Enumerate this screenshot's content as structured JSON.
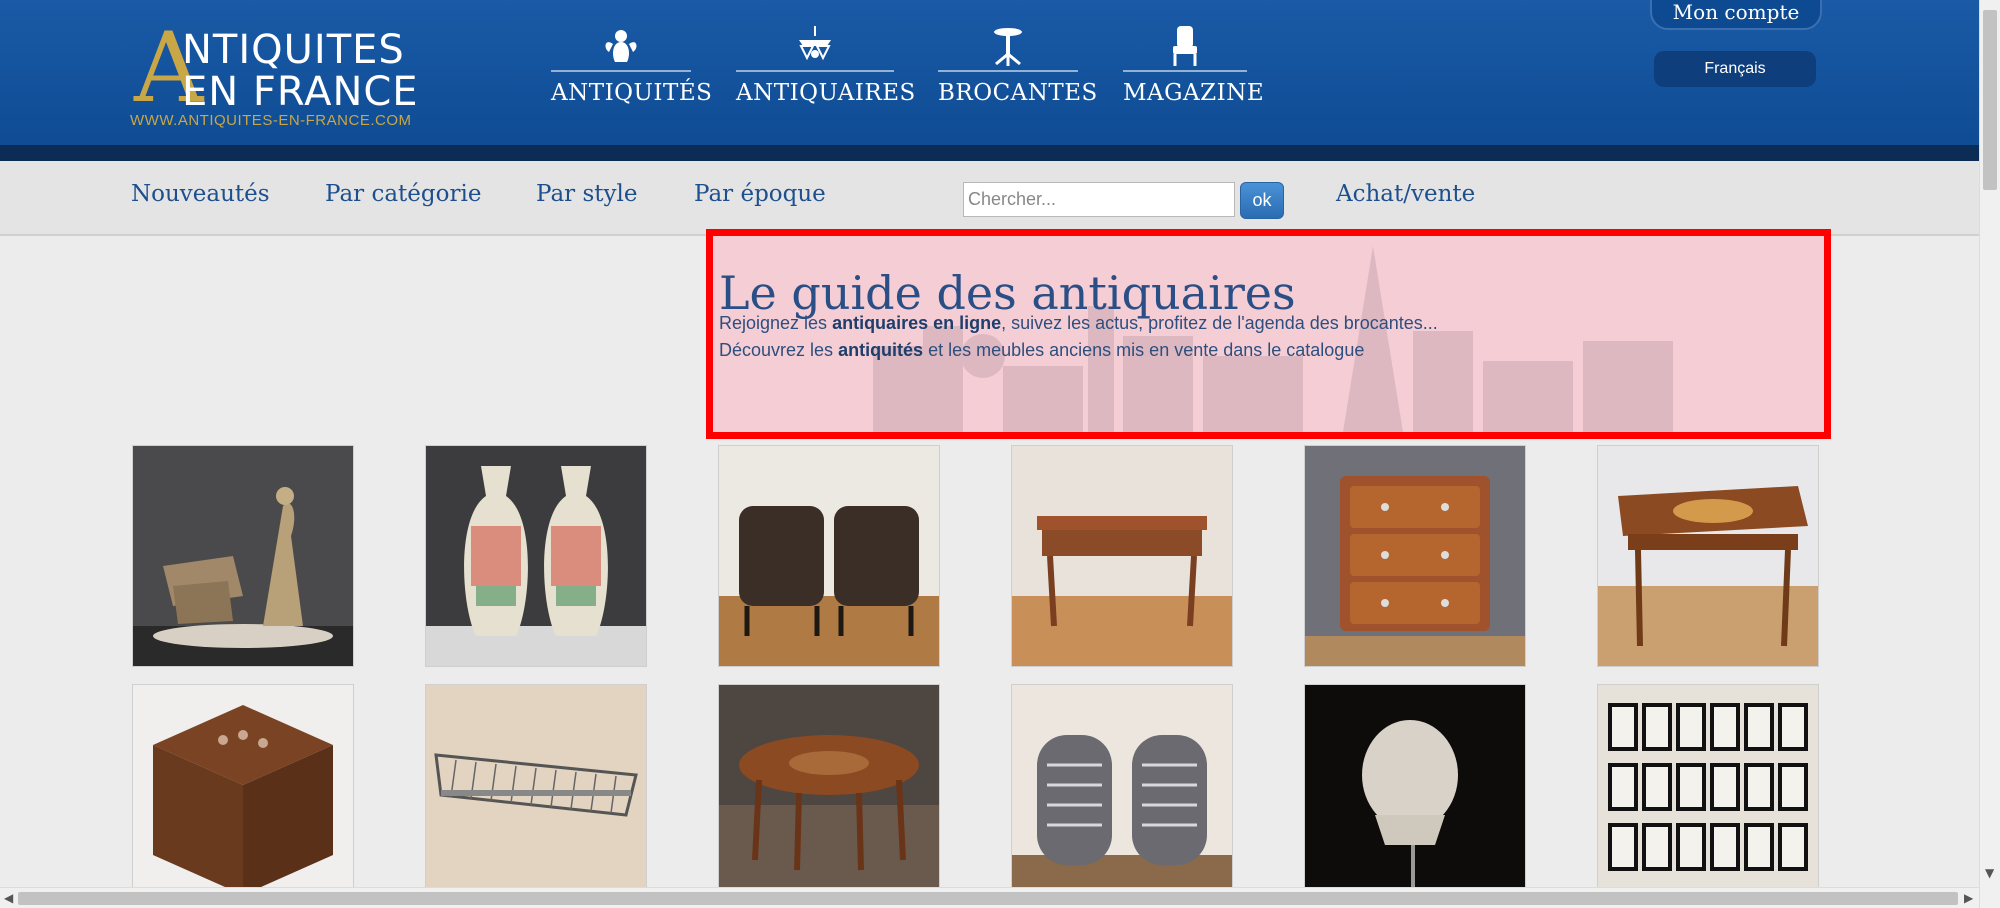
{
  "logo": {
    "big_letter": "A",
    "line1": "NTIQUITES",
    "line2": "EN FRANCE",
    "url": "WWW.ANTIQUITES-EN-FRANCE.COM"
  },
  "mainnav": [
    {
      "label": "ANTIQUITÉS",
      "icon": "cherub-icon"
    },
    {
      "label": "ANTIQUAIRES",
      "icon": "chandelier-icon"
    },
    {
      "label": "BROCANTES",
      "icon": "gueridon-table-icon"
    },
    {
      "label": "MAGAZINE",
      "icon": "armchair-icon"
    }
  ],
  "account": {
    "label": "Mon compte"
  },
  "language": {
    "selected": "Français"
  },
  "subnav": {
    "items": [
      "Nouveautés",
      "Par catégorie",
      "Par style",
      "Par époque"
    ],
    "search_placeholder": "Chercher...",
    "search_button": "ok",
    "achat_vente": "Achat/vente"
  },
  "hero": {
    "title": "Le guide des antiquaires",
    "line1_pre": "Rejoignez les ",
    "line1_bold": "antiquaires en ligne",
    "line1_post": ", suivez les actus, profitez de l'agenda des brocantes...",
    "line2_pre": "Découvrez les ",
    "line2_bold": "antiquités",
    "line2_post": " et les meubles anciens mis en vente dans le catalogue"
  },
  "products": [
    {
      "icon": "art-deco-sculpture-image"
    },
    {
      "icon": "canton-vases-image"
    },
    {
      "icon": "leather-club-chairs-image"
    },
    {
      "icon": "writing-table-image"
    },
    {
      "icon": "chest-of-drawers-image"
    },
    {
      "icon": "marquetry-table-image"
    },
    {
      "icon": "marquetry-box-image"
    },
    {
      "icon": "metal-rack-image"
    },
    {
      "icon": "round-table-image"
    },
    {
      "icon": "pair-of-armchairs-image"
    },
    {
      "icon": "plaster-bust-image"
    },
    {
      "icon": "herbarium-frames-image"
    }
  ],
  "colors": {
    "header_blue": "#0d4a92",
    "gold": "#c9a646",
    "link_blue": "#1d4f8e",
    "highlight_red": "#ff0000"
  }
}
